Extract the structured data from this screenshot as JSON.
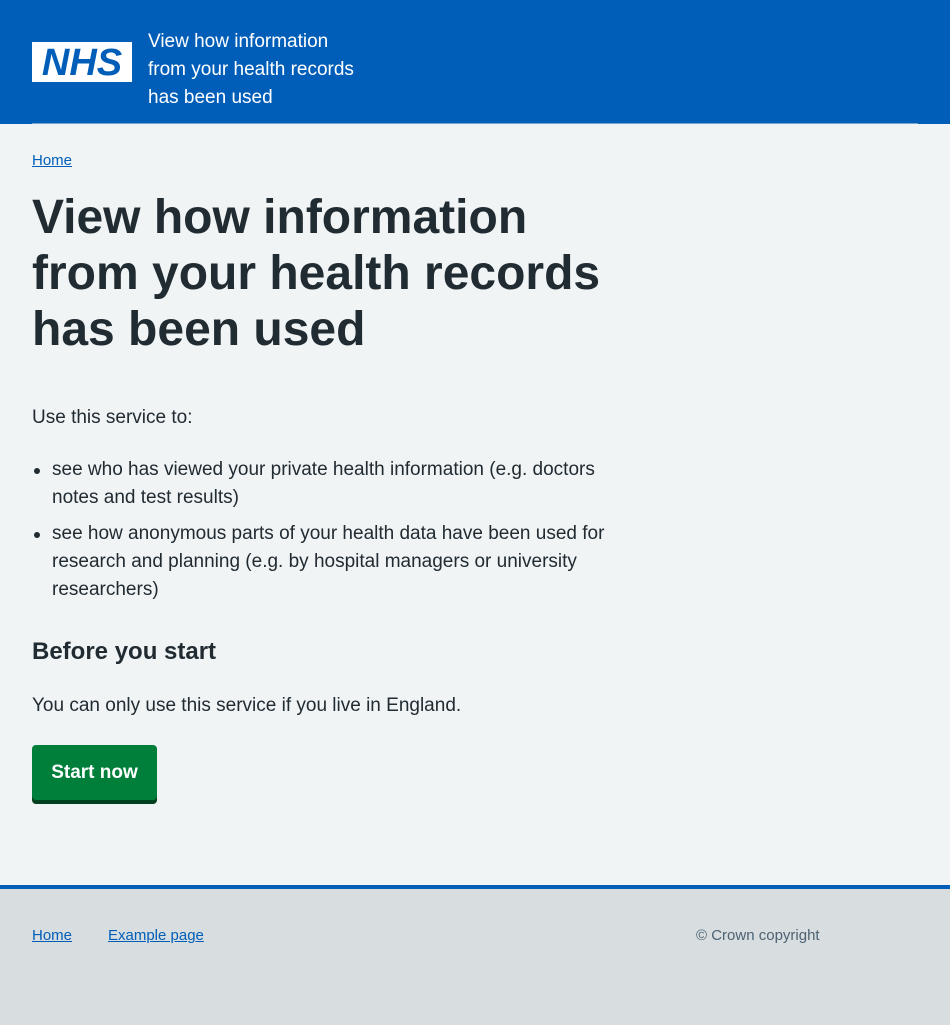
{
  "header": {
    "logo_text": "NHS",
    "service_name": "View how information from your health records has been used",
    "brand_color": "#005eb8"
  },
  "breadcrumb": {
    "home_label": "Home"
  },
  "main": {
    "title": "View how information from your health records has been used",
    "intro": "Use this service to:",
    "bullets": [
      "see who has viewed your private health information (e.g. doctors notes and test results)",
      "see how anonymous parts of your health data have been used for research and planning (e.g. by hospital managers or university researchers)"
    ],
    "subheading": "Before you start",
    "eligibility": "You can only use this service if you live in England.",
    "start_button_label": "Start now",
    "button_color": "#007f3b"
  },
  "footer": {
    "links": [
      "Home",
      "Example page"
    ],
    "copyright": "© Crown copyright"
  }
}
